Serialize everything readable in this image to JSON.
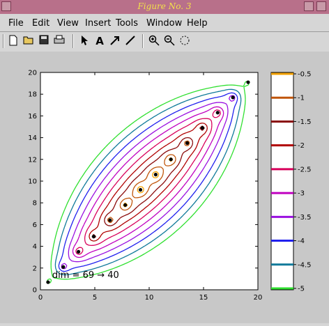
{
  "window": {
    "title": "Figure No. 3"
  },
  "menu": [
    "File",
    "Edit",
    "View",
    "Insert",
    "Tools",
    "Window",
    "Help"
  ],
  "toolbar": [
    "new",
    "open",
    "save",
    "print",
    "pointer",
    "text",
    "arrow",
    "line",
    "zoom-in",
    "zoom-out",
    "rotate"
  ],
  "chart_data": {
    "type": "contour",
    "xlim": [
      0,
      20
    ],
    "ylim": [
      0,
      20
    ],
    "xticks": [
      0,
      5,
      10,
      15,
      20
    ],
    "yticks": [
      0,
      2,
      4,
      6,
      8,
      10,
      12,
      14,
      16,
      18,
      20
    ],
    "annotation": "dim = 69 → 40",
    "points": [
      [
        0.7,
        0.7
      ],
      [
        2.1,
        2.1
      ],
      [
        3.5,
        3.5
      ],
      [
        4.9,
        4.9
      ],
      [
        6.4,
        6.4
      ],
      [
        7.8,
        7.8
      ],
      [
        9.2,
        9.2
      ],
      [
        10.6,
        10.6
      ],
      [
        12.0,
        12.0
      ],
      [
        13.5,
        13.5
      ],
      [
        14.9,
        14.9
      ],
      [
        16.3,
        16.3
      ],
      [
        17.7,
        17.7
      ],
      [
        19.1,
        19.1
      ]
    ],
    "colorbar": {
      "levels": [
        -0.5,
        -1,
        -1.5,
        -2,
        -2.5,
        -3,
        -3.5,
        -4,
        -4.5,
        -5
      ],
      "labels": [
        "-0.5",
        "-1",
        "-1.5",
        "-2",
        "-2.5",
        "-3",
        "-3.5",
        "-4",
        "-4.5",
        "-5"
      ],
      "colors": [
        "#f4a300",
        "#c0550a",
        "#8a0a0a",
        "#b00000",
        "#d8005a",
        "#c000c0",
        "#9a10e0",
        "#2020ee",
        "#107a9a",
        "#30e030"
      ]
    }
  }
}
